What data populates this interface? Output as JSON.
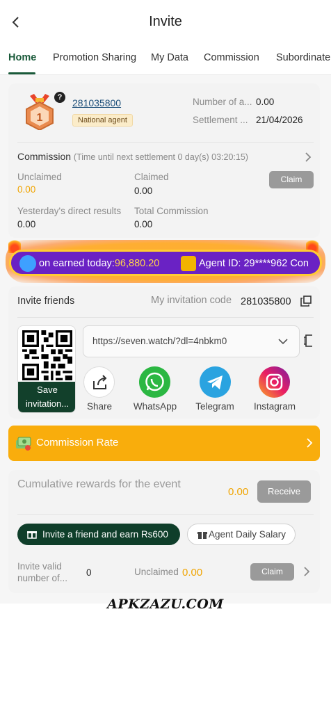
{
  "header": {
    "title": "Invite"
  },
  "tabs": [
    {
      "label": "Home"
    },
    {
      "label": "Promotion Sharing"
    },
    {
      "label": "My Data"
    },
    {
      "label": "Commission"
    },
    {
      "label": "Subordinate"
    }
  ],
  "agent": {
    "level": "1",
    "id": "281035800",
    "badge": "National agent",
    "number_label": "Number of a...",
    "number_value": "0.00",
    "settlement_label": "Settlement ...",
    "settlement_value": "21/04/2026"
  },
  "commission": {
    "title": "Commission",
    "note": "(Time until next settlement 0 day(s) 03:20:15)",
    "unclaimed_label": "Unclaimed",
    "unclaimed_value": "0.00",
    "claimed_label": "Claimed",
    "claimed_value": "0.00",
    "claim_button": "Claim",
    "yesterday_label": "Yesterday's direct results",
    "yesterday_value": "0.00",
    "total_label": "Total Commission",
    "total_value": "0.00"
  },
  "marquee": {
    "earned_label": "on earned today:",
    "earned_value": "96,880.20",
    "agent_text": "Agent ID: 29****962 Con"
  },
  "invite": {
    "title": "Invite friends",
    "code_label": "My invitation code",
    "code_value": "281035800",
    "save_label": "Save invitation...",
    "link": "https://seven.watch/?dl=4nbkm0",
    "share_items": [
      {
        "label": "Share",
        "icon": "share-icon"
      },
      {
        "label": "WhatsApp",
        "icon": "whatsapp-icon"
      },
      {
        "label": "Telegram",
        "icon": "telegram-icon"
      },
      {
        "label": "Instagram",
        "icon": "instagram-icon"
      }
    ]
  },
  "rate": {
    "label": "Commission Rate"
  },
  "rewards": {
    "title": "Cumulative rewards for the event",
    "value": "0.00",
    "receive_button": "Receive",
    "invite_button": "Invite a friend and earn Rs600",
    "salary_button": "Agent Daily Salary",
    "valid_label": "Invite valid number of...",
    "valid_value": "0",
    "unclaimed_label": "Unclaimed",
    "unclaimed_value": "0.00",
    "claim_button": "Claim"
  },
  "watermark": "APKZAZU.COM",
  "colors": {
    "brand_green": "#1a5a3a",
    "dark_green": "#0f3e2a",
    "orange": "#f9ad0c",
    "value_orange": "#f0a400",
    "marquee_purple": "#6a22c4"
  }
}
